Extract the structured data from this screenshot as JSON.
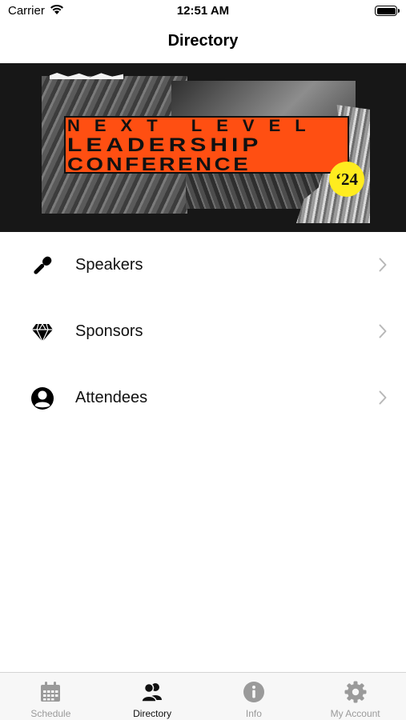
{
  "status_bar": {
    "carrier": "Carrier",
    "time": "12:51 AM"
  },
  "nav": {
    "title": "Directory"
  },
  "banner": {
    "line1": "NEXT LEVEL",
    "line2": "LEADERSHIP",
    "line3": "CONFERENCE",
    "year": "‘24",
    "colors": {
      "strip": "#ff4f12",
      "badge": "#ffec1f",
      "background": "#171717"
    }
  },
  "directory": {
    "items": [
      {
        "label": "Speakers",
        "icon": "microphone-icon"
      },
      {
        "label": "Sponsors",
        "icon": "diamond-icon"
      },
      {
        "label": "Attendees",
        "icon": "person-circle-icon"
      }
    ]
  },
  "tab_bar": {
    "tabs": [
      {
        "label": "Schedule",
        "icon": "calendar-icon",
        "active": false
      },
      {
        "label": "Directory",
        "icon": "people-icon",
        "active": true
      },
      {
        "label": "Info",
        "icon": "info-icon",
        "active": false
      },
      {
        "label": "My Account",
        "icon": "gear-icon",
        "active": false
      }
    ]
  }
}
